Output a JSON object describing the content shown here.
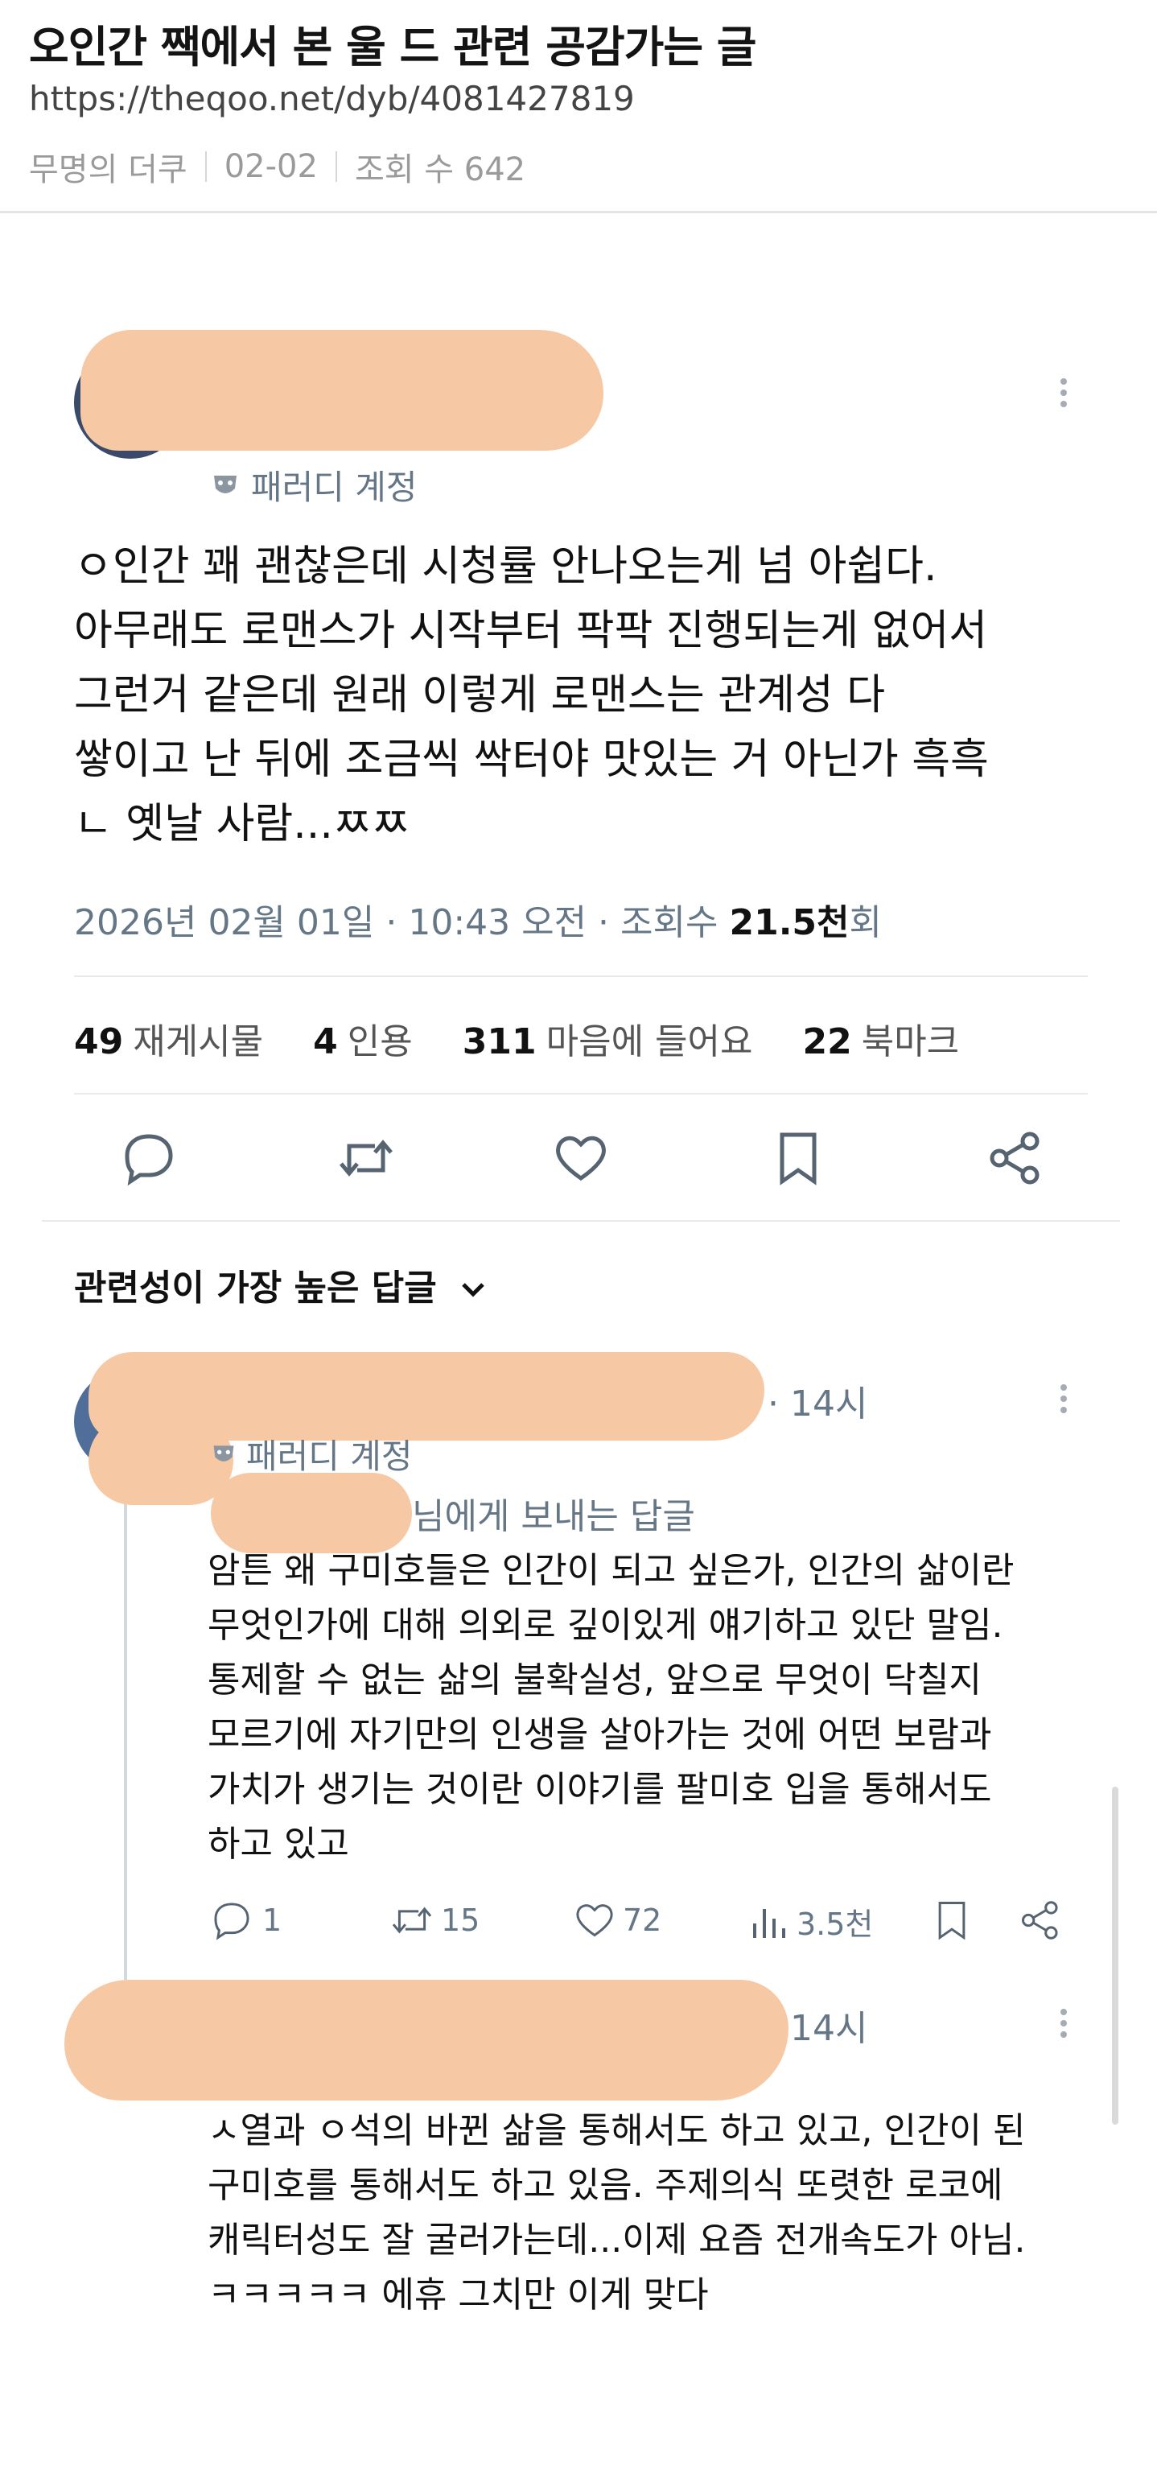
{
  "header": {
    "title": "오인간 짹에서 본 울 드 관련 공감가는 글",
    "url": "https://theqoo.net/dyb/4081427819",
    "author": "무명의 더쿠",
    "date": "02-02",
    "views": "조회 수 642"
  },
  "tweet": {
    "account_badge": "패러디 계정",
    "body": [
      "ㅇ인간 꽤 괜찮은데 시청률 안나오는게 넘 아쉽다.",
      "아무래도 로맨스가 시작부터 팍팍 진행되는게 없어서",
      "그런거 같은데 원래 이렇게 로맨스는 관계성 다",
      "쌓이고 난 뒤에 조금씩 싹터야 맛있는 거 아닌가 흑흑",
      "ㄴ 옛날 사람...ㅉㅉ"
    ],
    "meta_prefix": "2026년 02월 01일 · 10:43 오전 · 조회수 ",
    "views_count": "21.5천",
    "views_suffix": "회",
    "stats": [
      {
        "count": "49",
        "label": "재게시물"
      },
      {
        "count": "4",
        "label": "인용"
      },
      {
        "count": "311",
        "label": "마음에 들어요"
      },
      {
        "count": "22",
        "label": "북마크"
      }
    ],
    "actions": [
      "reply-icon",
      "retweet-icon",
      "like-icon",
      "bookmark-icon",
      "share-icon"
    ]
  },
  "replies_sort": "관련성이 가장 높은 답글",
  "replies": [
    {
      "time": "· 14시",
      "badge": "패러디 계정",
      "reply_to": "님에게 보내는 답글",
      "lines": [
        "암튼 왜 구미호들은 인간이 되고 싶은가, 인간의 삶이란",
        "무엇인가에 대해 의외로 깊이있게 얘기하고 있단 말임.",
        "통제할 수 없는 삶의 불확실성, 앞으로 무엇이 닥칠지",
        "모르기에 자기만의 인생을 살아가는 것에 어떤 보람과",
        "가치가 생기는 것이란 이야기를 팔미호 입을 통해서도",
        "하고 있고"
      ],
      "replies_count": "1",
      "retweets": "15",
      "likes": "72",
      "views": "3.5천"
    },
    {
      "time": "14시",
      "lines": [
        "ㅅ열과 ㅇ석의 바뀐 삶을 통해서도 하고 있고, 인간이 된",
        "구미호를 통해서도 하고 있음.  주제의식 또렷한 로코에",
        "캐릭터성도 잘 굴러가는데...이제 요즘 전개속도가 아님.",
        "ㅋㅋㅋㅋㅋ 에휴 그치만 이게 맞다"
      ]
    }
  ],
  "colors": {
    "redaction": "#f6c9a4",
    "muted": "#657786",
    "rule": "#e8ebee"
  }
}
